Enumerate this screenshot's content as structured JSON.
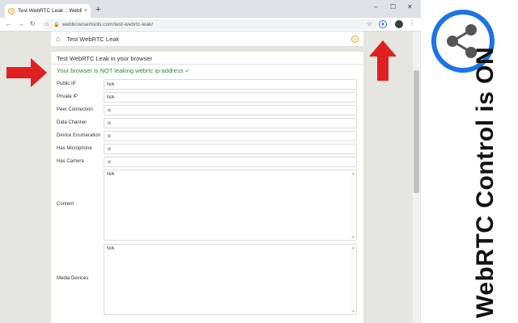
{
  "browser": {
    "tab_title": "Test WebRTC Leak :: WebBrowser",
    "tab_close": "×",
    "new_tab": "+",
    "url": "webbrowsertools.com/test-webrtc-leak/",
    "window_controls": [
      "–",
      "☐",
      "✕"
    ]
  },
  "page": {
    "header_title": "Test WebRTC Leak",
    "card_title": "Test WebRTC Leak in your browser",
    "status": "Your browser is NOT leaking webrtc ip-address ✓",
    "status_color": "#2e8b2e",
    "rows": [
      {
        "label": "Public IP",
        "value": "N/A"
      },
      {
        "label": "Private IP",
        "value": "N/A"
      },
      {
        "label": "Peer Connection",
        "value": "✕"
      },
      {
        "label": "Data Channel",
        "value": "✕"
      },
      {
        "label": "Device Enumeration",
        "value": "✕"
      },
      {
        "label": "Has Microphone",
        "value": "✕"
      },
      {
        "label": "Has Camera",
        "value": "✕"
      }
    ],
    "content": {
      "label": "Content",
      "value": "N/A"
    },
    "media_devices": {
      "label": "Media Devices",
      "value": "N/A"
    }
  },
  "promo": {
    "text": "WebRTC Control is ON",
    "accent_color": "#1a73e8",
    "icon": "share-icon"
  },
  "arrows": {
    "color": "#e02020"
  }
}
